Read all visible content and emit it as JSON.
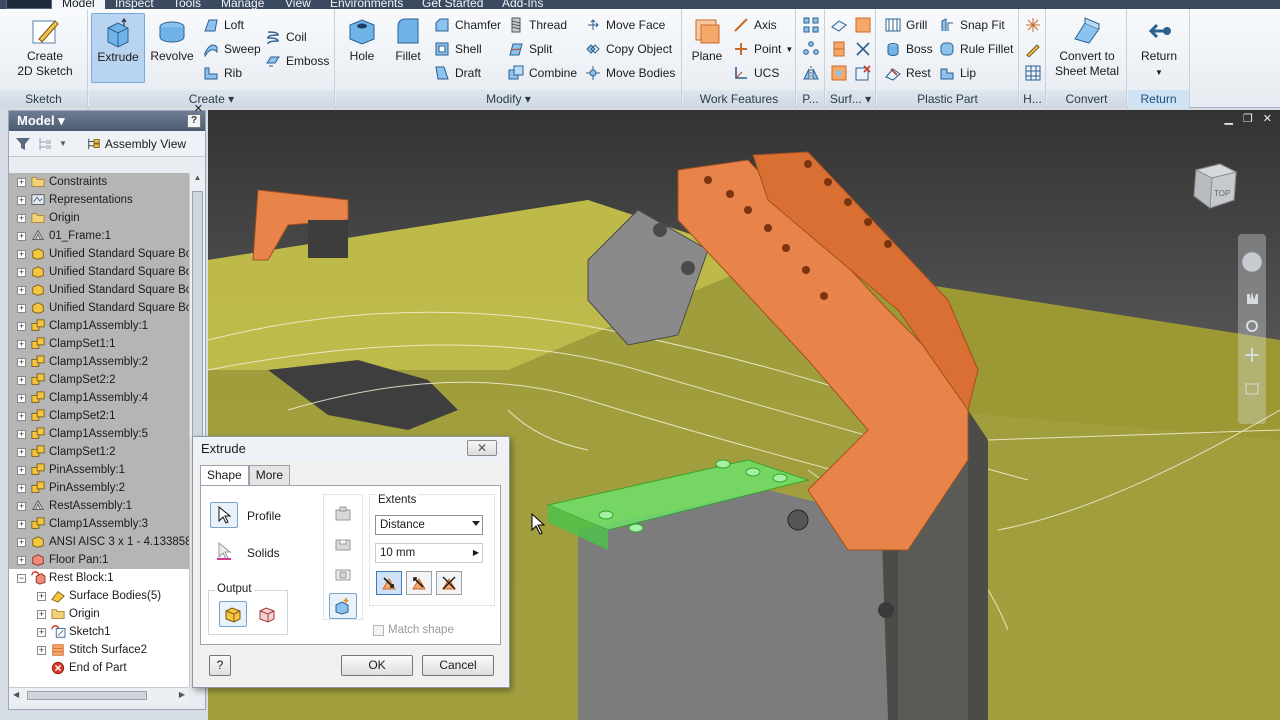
{
  "menubar": {
    "items": [
      "Model",
      "Inspect",
      "Tools",
      "Manage",
      "View",
      "Environments",
      "Get Started",
      "Add-Ins"
    ],
    "active": "Model"
  },
  "ribbon": {
    "sketch": {
      "create_2d_sketch": [
        "Create",
        "2D Sketch"
      ],
      "label": "Sketch"
    },
    "create": {
      "extrude": "Extrude",
      "revolve": "Revolve",
      "loft": "Loft",
      "sweep": "Sweep",
      "rib": "Rib",
      "coil": "Coil",
      "emboss": "Emboss",
      "label": "Create"
    },
    "modify": {
      "hole": "Hole",
      "fillet": "Fillet",
      "chamfer": "Chamfer",
      "shell": "Shell",
      "draft": "Draft",
      "thread": "Thread",
      "split": "Split",
      "combine": "Combine",
      "move_face": "Move Face",
      "copy_object": "Copy Object",
      "move_bodies": "Move Bodies",
      "label": "Modify"
    },
    "work_features": {
      "plane": "Plane",
      "axis": "Axis",
      "point": "Point",
      "ucs": "UCS",
      "label": "Work Features"
    },
    "pattern": {
      "label": "P..."
    },
    "surface": {
      "label": "Surf..."
    },
    "plastic_part": {
      "grill": "Grill",
      "boss": "Boss",
      "rest": "Rest",
      "snap_fit": "Snap Fit",
      "rule_fillet": "Rule Fillet",
      "lip": "Lip",
      "label": "Plastic Part"
    },
    "harness": {
      "label": "H..."
    },
    "convert": {
      "convert_to_sheet_metal": [
        "Convert to",
        "Sheet Metal"
      ],
      "label": "Convert"
    },
    "return": {
      "return": "Return",
      "label": "Return"
    }
  },
  "browser": {
    "title": "Model",
    "help": "?",
    "assembly_view": "Assembly View",
    "tree": [
      {
        "label": "Constraints",
        "icon": "folder-icon",
        "expander": "+",
        "indent": 0,
        "selected": true
      },
      {
        "label": "Representations",
        "icon": "representations-icon",
        "expander": "+",
        "indent": 0,
        "selected": true
      },
      {
        "label": "Origin",
        "icon": "folder-icon",
        "expander": "+",
        "indent": 0,
        "selected": true
      },
      {
        "label": "01_Frame:1",
        "icon": "frame-part-icon",
        "expander": "+",
        "indent": 0,
        "selected": true
      },
      {
        "label": "Unified Standard Square Bo",
        "icon": "part-icon",
        "expander": "+",
        "indent": 0,
        "selected": true
      },
      {
        "label": "Unified Standard Square Bo",
        "icon": "part-icon",
        "expander": "+",
        "indent": 0,
        "selected": true
      },
      {
        "label": "Unified Standard Square Bo",
        "icon": "part-icon",
        "expander": "+",
        "indent": 0,
        "selected": true
      },
      {
        "label": "Unified Standard Square Bo",
        "icon": "part-icon",
        "expander": "+",
        "indent": 0,
        "selected": true
      },
      {
        "label": "Clamp1Assembly:1",
        "icon": "assembly-icon",
        "expander": "+",
        "indent": 0,
        "selected": true
      },
      {
        "label": "ClampSet1:1",
        "icon": "assembly-icon",
        "expander": "+",
        "indent": 0,
        "selected": true
      },
      {
        "label": "Clamp1Assembly:2",
        "icon": "assembly-icon",
        "expander": "+",
        "indent": 0,
        "selected": true
      },
      {
        "label": "ClampSet2:2",
        "icon": "assembly-icon",
        "expander": "+",
        "indent": 0,
        "selected": true
      },
      {
        "label": "Clamp1Assembly:4",
        "icon": "assembly-icon",
        "expander": "+",
        "indent": 0,
        "selected": true
      },
      {
        "label": "ClampSet2:1",
        "icon": "assembly-icon",
        "expander": "+",
        "indent": 0,
        "selected": true
      },
      {
        "label": "Clamp1Assembly:5",
        "icon": "assembly-icon",
        "expander": "+",
        "indent": 0,
        "selected": true
      },
      {
        "label": "ClampSet1:2",
        "icon": "assembly-icon",
        "expander": "+",
        "indent": 0,
        "selected": true
      },
      {
        "label": "PinAssembly:1",
        "icon": "assembly-icon",
        "expander": "+",
        "indent": 0,
        "selected": true
      },
      {
        "label": "PinAssembly:2",
        "icon": "assembly-icon",
        "expander": "+",
        "indent": 0,
        "selected": true
      },
      {
        "label": "RestAssembly:1",
        "icon": "frame-part-icon",
        "expander": "+",
        "indent": 0,
        "selected": true
      },
      {
        "label": "Clamp1Assembly:3",
        "icon": "assembly-icon",
        "expander": "+",
        "indent": 0,
        "selected": true
      },
      {
        "label": "ANSI AISC 3 x 1 - 4.133858",
        "icon": "part-icon",
        "expander": "+",
        "indent": 0,
        "selected": true
      },
      {
        "label": "Floor Pan:1",
        "icon": "part-red-icon",
        "expander": "+",
        "indent": 0,
        "selected": true
      },
      {
        "label": "Rest Block:1",
        "icon": "part-edit-icon",
        "expander": "-",
        "indent": 0,
        "selected": false
      },
      {
        "label": "Surface Bodies(5)",
        "icon": "surface-bodies-icon",
        "expander": "+",
        "indent": 1,
        "selected": false
      },
      {
        "label": "Origin",
        "icon": "folder-icon",
        "expander": "+",
        "indent": 1,
        "selected": false
      },
      {
        "label": "Sketch1",
        "icon": "sketch-icon",
        "expander": "+",
        "indent": 1,
        "selected": false
      },
      {
        "label": "Stitch Surface2",
        "icon": "stitch-surface-icon",
        "expander": "+",
        "indent": 1,
        "selected": false
      },
      {
        "label": "End of Part",
        "icon": "end-of-part-icon",
        "expander": "",
        "indent": 1,
        "selected": false
      }
    ]
  },
  "viewcube": {
    "face_label": "TOP"
  },
  "dialog": {
    "title": "Extrude",
    "close": "✕",
    "tabs": [
      "Shape",
      "More"
    ],
    "active_tab": "Shape",
    "profile": "Profile",
    "solids": "Solids",
    "output": "Output",
    "extents": "Extents",
    "extents_type": "Distance",
    "distance": "10 mm",
    "match_shape": "Match shape",
    "ok": "OK",
    "cancel": "Cancel",
    "help": "?"
  },
  "colors": {
    "ribbon_bg": "#eef2f6",
    "selection_blue": "#b9d4f0",
    "part_orange": "#e8844a",
    "surface_yellow": "#b5b23a",
    "profile_green": "#6fe06a"
  }
}
